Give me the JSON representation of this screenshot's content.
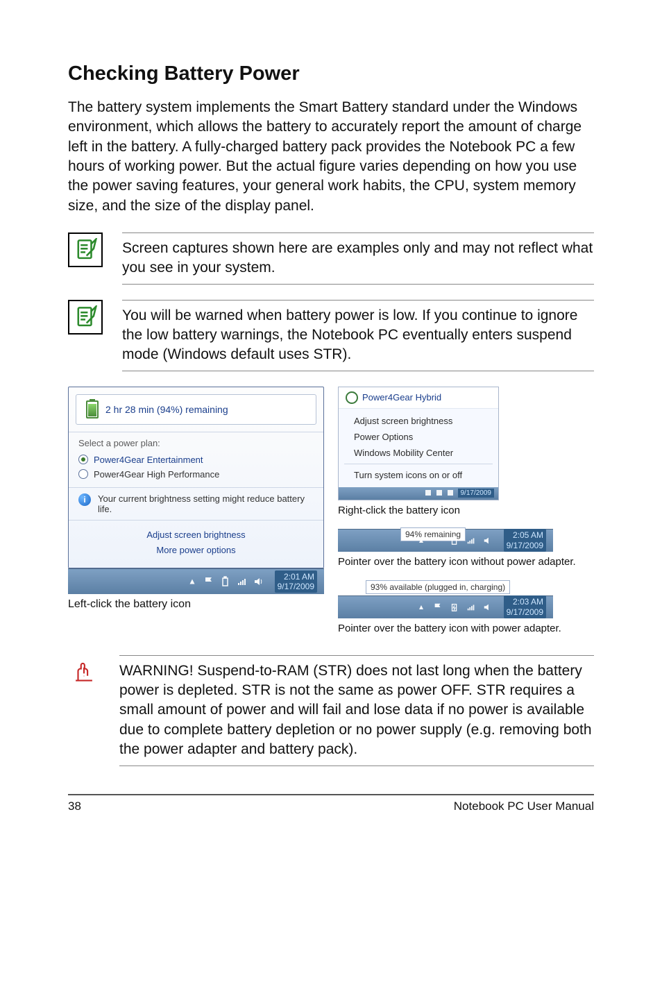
{
  "title": "Checking Battery Power",
  "intro": "The battery system implements the Smart Battery standard under the Windows environment, which allows the battery to accurately report the amount of charge left in the battery. A fully-charged battery pack provides the Notebook PC a few hours of working power. But the actual figure varies depending on how you use the power saving features, your general work habits, the CPU, system memory size, and the size of the display panel.",
  "note1": "Screen captures shown here are examples only and may not reflect what you see in your system.",
  "note2": "You will be warned when battery power is low. If you continue to ignore the low battery warnings, the Notebook PC eventually enters suspend mode (Windows default uses STR).",
  "left_popup": {
    "remaining": "2 hr 28 min (94%) remaining",
    "plan_header": "Select a power plan:",
    "plan1": "Power4Gear Entertainment",
    "plan2": "Power4Gear High Performance",
    "brightness_tip": "Your current brightness setting might reduce battery life.",
    "link1": "Adjust screen brightness",
    "link2": "More power options",
    "time": "2:01 AM",
    "date": "9/17/2009",
    "caption": "Left-click the battery icon"
  },
  "ctx": {
    "header": "Power4Gear Hybrid",
    "i1": "Adjust screen brightness",
    "i2": "Power Options",
    "i3": "Windows Mobility Center",
    "i4": "Turn system icons on or off",
    "date": "9/17/2009",
    "caption": "Right-click the battery icon"
  },
  "tip_unplugged": {
    "tooltip": "94% remaining",
    "time": "2:05 AM",
    "date": "9/17/2009",
    "caption": "Pointer over the battery icon without power adapter."
  },
  "tip_plugged": {
    "tooltip": "93% available (plugged in, charging)",
    "time": "2:03 AM",
    "date": "9/17/2009",
    "caption": "Pointer over the battery icon with power adapter."
  },
  "warning": "WARNING!  Suspend-to-RAM (STR) does not last long when the battery power is depleted. STR is not the same as power OFF. STR requires a small amount of power and will fail and lose data if no power is available due to complete battery depletion or no power supply (e.g. removing both the power adapter and battery pack).",
  "footer": {
    "page": "38",
    "label": "Notebook PC User Manual"
  }
}
